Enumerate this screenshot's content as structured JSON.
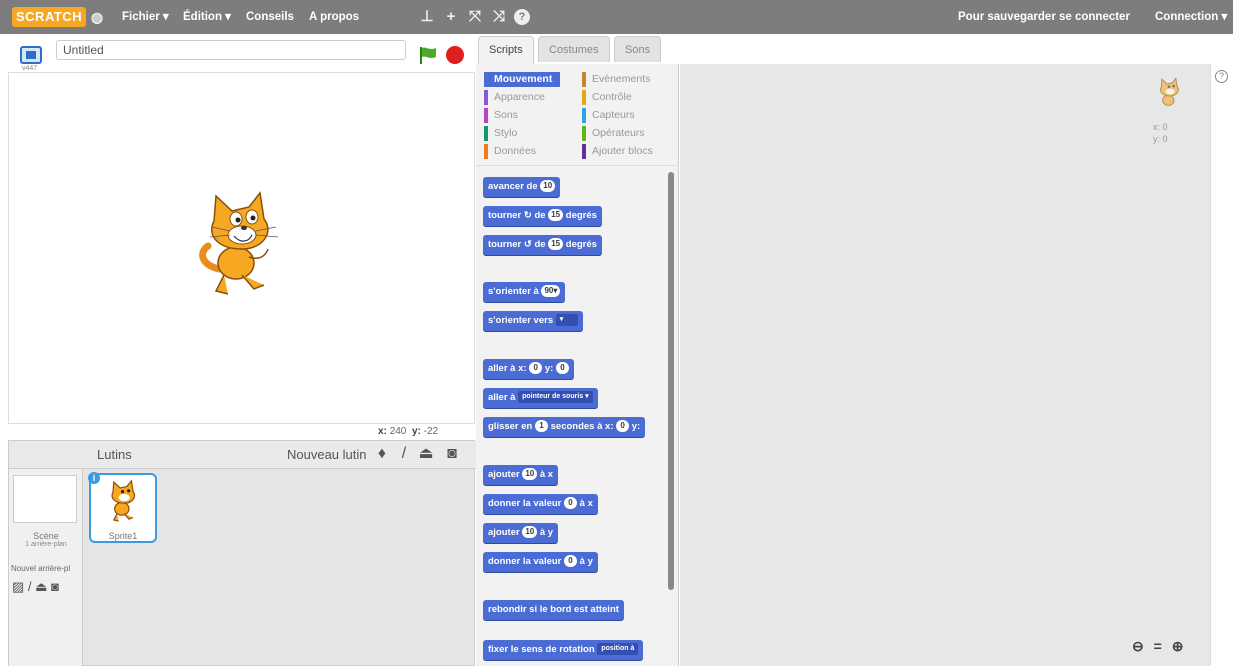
{
  "topbar": {
    "logo": "SCRATCH",
    "menu": [
      "Fichier ▾",
      "Édition ▾",
      "Conseils",
      "A propos"
    ],
    "save_hint": "Pour sauvegarder se connecter",
    "connect": "Connection ▾",
    "tools": [
      "duplicate-stamp-icon",
      "cut-icon",
      "grow-icon",
      "shrink-icon",
      "help-icon"
    ]
  },
  "stage": {
    "version": "v447",
    "project_title": "Untitled",
    "coord_x_label": "x:",
    "coord_x_value": "240",
    "coord_y_label": "y:",
    "coord_y_value": "-22"
  },
  "sprites": {
    "header": "Lutins",
    "new_sprite": "Nouveau lutin",
    "scene_label": "Scène",
    "scene_sub": "1 arrière-plan",
    "new_backdrop": "Nouvel arrière-pl",
    "sprite1_label": "Sprite1"
  },
  "tabs": [
    "Scripts",
    "Costumes",
    "Sons"
  ],
  "categories": [
    {
      "label": "Mouvement",
      "color": "#4a6cd4",
      "active": true
    },
    {
      "label": "Evènements",
      "color": "#c88330"
    },
    {
      "label": "Apparence",
      "color": "#8a55d7"
    },
    {
      "label": "Contrôle",
      "color": "#e1a91a"
    },
    {
      "label": "Sons",
      "color": "#bb42c3"
    },
    {
      "label": "Capteurs",
      "color": "#2ca5e2"
    },
    {
      "label": "Stylo",
      "color": "#0e9a6c"
    },
    {
      "label": "Opérateurs",
      "color": "#5cb712"
    },
    {
      "label": "Données",
      "color": "#ee7d16"
    },
    {
      "label": "Ajouter blocs",
      "color": "#632d99"
    }
  ],
  "blocks": {
    "b1_text": "avancer de",
    "b1_val": "10",
    "b2_pre": "tourner",
    "b2_mid": "de",
    "b2_val": "15",
    "b2_post": "degrés",
    "b3_pre": "tourner",
    "b3_mid": "de",
    "b3_val": "15",
    "b3_post": "degrés",
    "b4_text": "s'orienter à",
    "b4_val": "90▾",
    "b5_text": "s'orienter vers",
    "b5_drop": "▾",
    "b6_pre": "aller à x:",
    "b6_x": "0",
    "b6_mid": "y:",
    "b6_y": "0",
    "b7_text": "aller à",
    "b7_drop": "pointeur de souris ▾",
    "b8_pre": "glisser en",
    "b8_s": "1",
    "b8_mid": "secondes à x:",
    "b8_x": "0",
    "b8_y_label": "y:",
    "b9_pre": "ajouter",
    "b9_val": "10",
    "b9_post": "à x",
    "b10_pre": "donner la valeur",
    "b10_val": "0",
    "b10_post": "à x",
    "b11_pre": "ajouter",
    "b11_val": "10",
    "b11_post": "à y",
    "b12_pre": "donner la valeur",
    "b12_val": "0",
    "b12_post": "à y",
    "b13_text": "rebondir si le bord est atteint",
    "b14_text": "fixer le sens de rotation",
    "b14_drop": "position à"
  },
  "script_area": {
    "corner_x": "x: 0",
    "corner_y": "y: 0",
    "zoom_out": "🔍︎−",
    "zoom_reset": "=",
    "zoom_in": "🔍︎+",
    "help": "?"
  }
}
